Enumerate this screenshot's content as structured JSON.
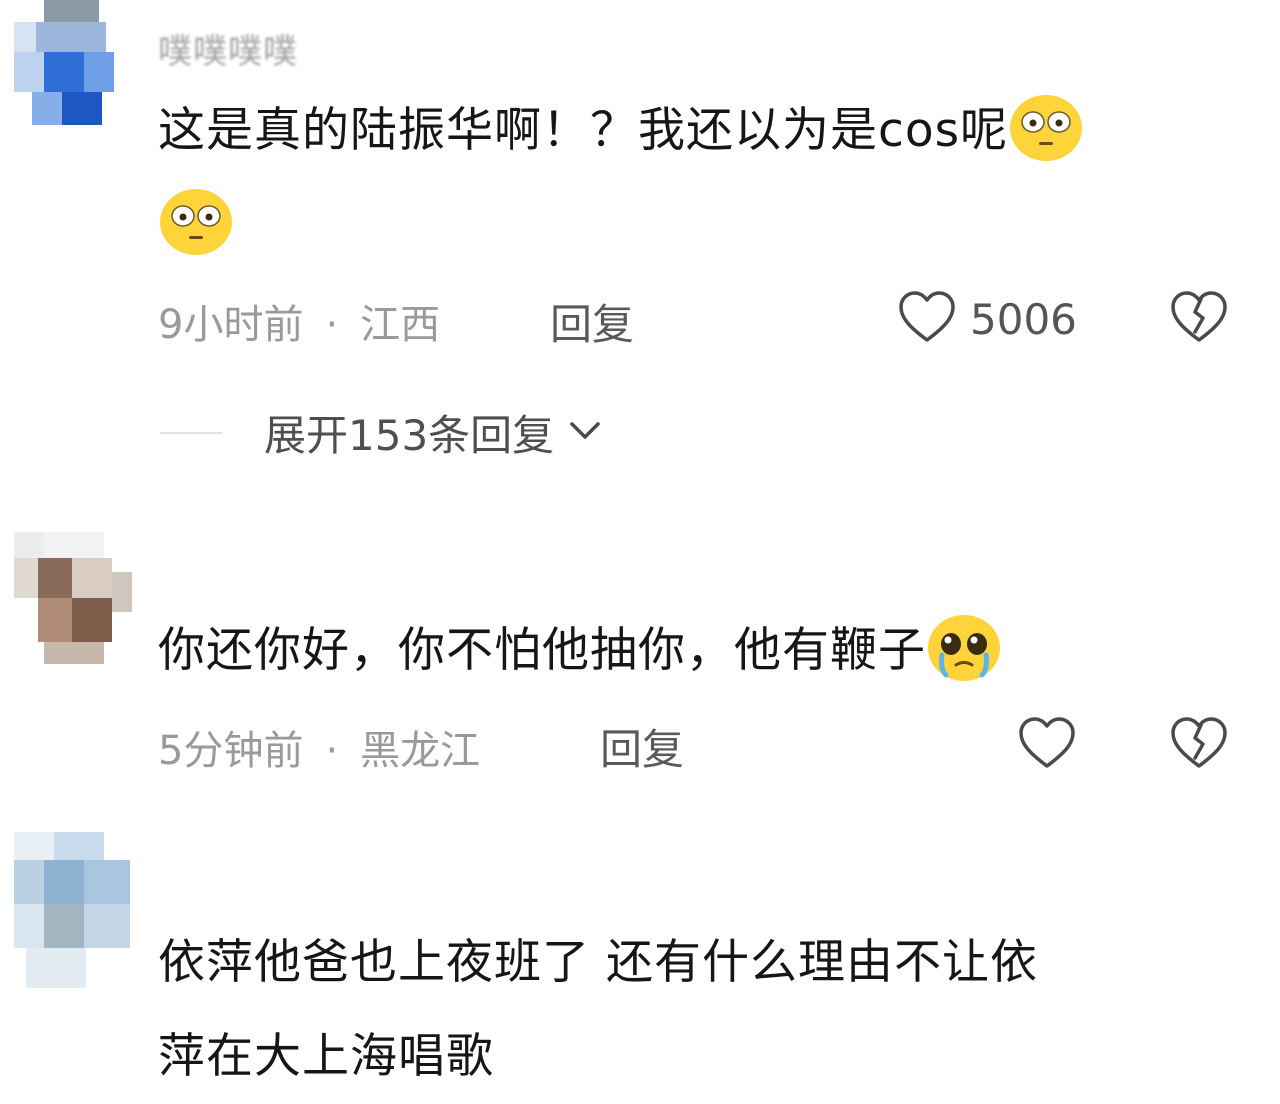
{
  "comments": [
    {
      "username": "噗噗噗噗",
      "text": "这是真的陆振华啊！？我还以为是cos呢",
      "emojis": [
        "flushed-face-emoji",
        "flushed-face-emoji"
      ],
      "time": "9小时前",
      "location": "江西",
      "reply_label": "回复",
      "like_count": "5006",
      "expand_replies": "展开153条回复"
    },
    {
      "username": "",
      "text": "你还你好，你不怕他抽你，他有鞭子",
      "emojis": [
        "pleading-crying-face-emoji"
      ],
      "time": "5分钟前",
      "location": "黑龙江",
      "reply_label": "回复",
      "like_count": ""
    },
    {
      "username": "",
      "text_line1": "依萍他爸也上夜班了 还有什么理由不让依",
      "text_line2": "萍在大上海唱歌"
    }
  ],
  "separator": "·",
  "colors": {
    "text": "#161616",
    "meta": "#9a9a9a",
    "emoji_yellow": "#ffd43b",
    "icon_stroke": "#4a4a4a"
  }
}
